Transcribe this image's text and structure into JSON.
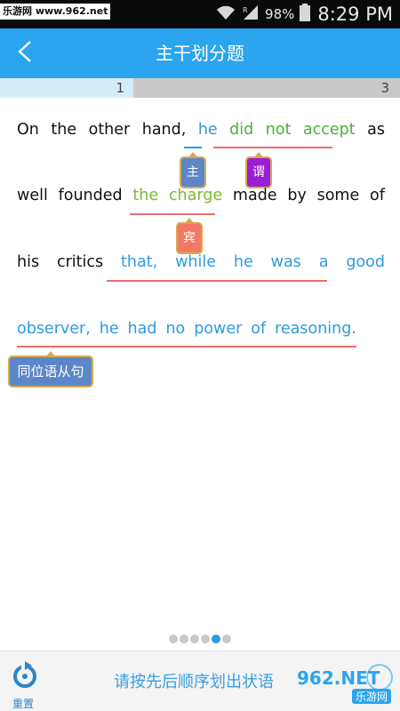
{
  "status_bar": {
    "watermark": "乐游网 www.962.net",
    "battery": "98%",
    "time": "8:29 PM"
  },
  "header": {
    "title": "主干划分题"
  },
  "progress": {
    "current": "1",
    "total": "3",
    "fraction": 0.333
  },
  "sentence": {
    "line1": [
      "On",
      "the",
      "other",
      "hand,",
      "he",
      "did",
      "not",
      "accept",
      "as"
    ],
    "line2": [
      "well",
      "founded",
      "the",
      "charge",
      "made",
      "by",
      "some",
      "of"
    ],
    "line3": [
      "his",
      "critics",
      "that,",
      "while",
      "he",
      "was",
      "a",
      "good"
    ],
    "line4": [
      "observer,",
      "he",
      "had",
      "no",
      "power",
      "of",
      "reasoning."
    ]
  },
  "tags": {
    "subject": "主",
    "verb": "谓",
    "object": "宾",
    "appositive": "同位语从句"
  },
  "pagination": {
    "count": 6,
    "active_index": 4
  },
  "bottom": {
    "reset_label": "重置",
    "instruction": "请按先后顺序划出状语",
    "watermark_main": "962.NET",
    "watermark_sub": "乐游网"
  },
  "colors": {
    "accent": "#2aa5ee",
    "subject_tag": "#5c86c8",
    "verb_tag": "#9b1dd4",
    "object_tag": "#f07a66",
    "underline": "#ef6d6d"
  }
}
